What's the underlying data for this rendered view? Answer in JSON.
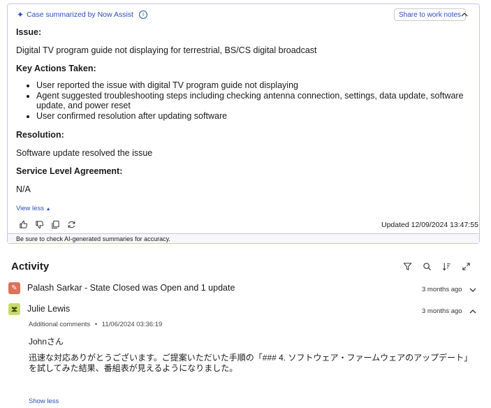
{
  "summary": {
    "header": "Case summarized by Now Assist",
    "share_label": "Share to work notes",
    "issue_heading": "Issue:",
    "issue_text": "Digital TV program guide not displaying for terrestrial, BS/CS digital broadcast",
    "actions_heading": "Key Actions Taken:",
    "actions": [
      "User reported the issue with digital TV program guide not displaying",
      "Agent suggested troubleshooting steps including checking antenna connection, settings, data update, software update, and power reset",
      "User confirmed resolution after updating software"
    ],
    "resolution_heading": "Resolution:",
    "resolution_text": "Software update resolved the issue",
    "sla_heading": "Service Level Agreement:",
    "sla_text": "N/A",
    "view_less": "View less",
    "updated": "Updated 12/09/2024 13:47:55",
    "disclaimer": "Be sure to check AI-generated summaries for accuracy."
  },
  "activity": {
    "title": "Activity",
    "entries": [
      {
        "name": "Palash Sarkar - State Closed was Open and 1 update",
        "time": "3 months ago",
        "icon_color": "#d9735c"
      },
      {
        "name": "Julie Lewis",
        "time": "3 months ago",
        "icon_color": "#c7dc6c",
        "meta_label": "Additional comments",
        "meta_sep": "•",
        "meta_time": "11/06/2024 03:36:19",
        "comment_line1": "Johnさん",
        "comment_line2": "迅速な対応ありがとうございます。ご提案いただいた手順の「### 4. ソフトウェア・ファームウェアのアップデート」を試してみた結果、番組表が見えるようになりました。",
        "show_less": "Show less"
      }
    ]
  },
  "colors": {
    "accent": "#2b4fb8",
    "card_border": "#c8c3ee"
  }
}
